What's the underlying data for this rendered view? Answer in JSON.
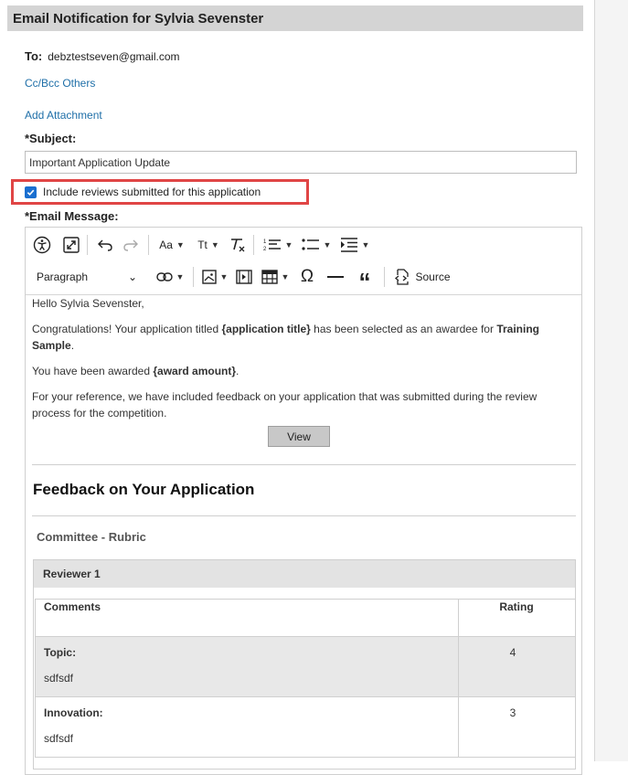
{
  "header": {
    "title": "Email Notification for Sylvia Sevenster"
  },
  "recipient": {
    "label": "To:",
    "email": "debztestseven@gmail.com"
  },
  "links": {
    "cc_bcc": "Cc/Bcc Others",
    "add_attachment": "Add Attachment"
  },
  "subject": {
    "label": "*Subject:",
    "value": "Important Application Update"
  },
  "include_reviews": {
    "label": "Include reviews submitted for this application",
    "checked": true
  },
  "message": {
    "label": "*Email Message:"
  },
  "toolbar": {
    "font_size_label": "Aa",
    "text_transform_label": "Tt",
    "paragraph_label": "Paragraph",
    "source_label": "Source",
    "icons": [
      "accessibility-icon",
      "maximize-icon",
      "undo-icon",
      "redo-icon",
      "font-size-icon",
      "text-transform-icon",
      "remove-format-icon",
      "numbered-list-icon",
      "bulleted-list-icon",
      "indent-icon",
      "link-icon",
      "image-icon",
      "media-icon",
      "table-icon",
      "special-character-icon",
      "horizontal-line-icon",
      "blockquote-icon",
      "source-icon"
    ]
  },
  "body": {
    "greeting": "Hello Sylvia Sevenster,",
    "para1_a": "Congratulations! Your application titled ",
    "para1_b": "{application title}",
    "para1_c": " has been selected as an awardee for ",
    "para1_d": "Training Sample",
    "para1_e": ".",
    "para2_a": "You have been awarded ",
    "para2_b": "{award amount}",
    "para2_c": ".",
    "para3": "For your reference, we have included feedback on your application that was submitted during the review process for the competition.",
    "view_button": "View",
    "feedback_heading": "Feedback on Your Application",
    "rubric_heading": "Committee - Rubric",
    "reviewer": "Reviewer 1",
    "columns": [
      "Comments",
      "Rating"
    ],
    "rows": [
      {
        "criterion": "Topic:",
        "comment": "sdfsdf",
        "rating": "4"
      },
      {
        "criterion": "Innovation:",
        "comment": "sdfsdf",
        "rating": "3"
      }
    ]
  }
}
